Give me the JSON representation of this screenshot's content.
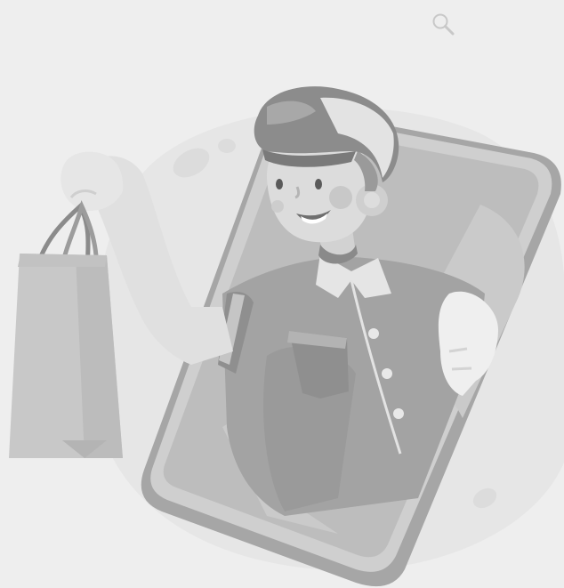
{
  "header": {
    "search_icon": "search-icon"
  },
  "illustration": {
    "subject": "delivery-person-emerging-from-phone-holding-shopping-bag"
  },
  "colors": {
    "background": "#eeeeee",
    "light": "#e2e2e2",
    "mid": "#c9c9c9",
    "dark": "#a9a9a9",
    "darker": "#8f8f8f",
    "outline": "#7e7e7e",
    "white": "#f9f9f9"
  }
}
